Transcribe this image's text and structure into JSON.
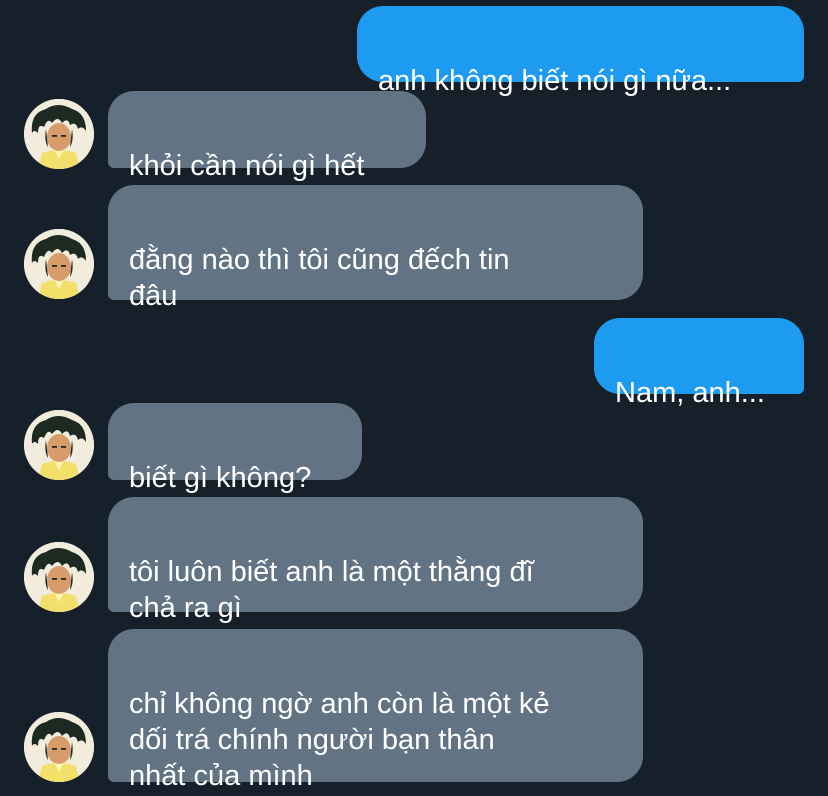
{
  "messages": [
    {
      "direction": "outgoing",
      "text": "anh không biết nói gì nữa..."
    },
    {
      "direction": "incoming",
      "text": "khỏi cần nói gì hết"
    },
    {
      "direction": "incoming",
      "text": "đằng nào thì tôi cũng đếch tin\nđâu"
    },
    {
      "direction": "outgoing",
      "text": "Nam, anh..."
    },
    {
      "direction": "incoming",
      "text": "biết gì không?"
    },
    {
      "direction": "incoming",
      "text": "tôi luôn biết anh là một thằng đĩ\nchả ra gì"
    },
    {
      "direction": "incoming",
      "text": "chỉ không ngờ anh còn là một kẻ\ndối trá chính người bạn thân\nnhất của mình"
    }
  ],
  "avatar": {
    "icon": "anime-character-avatar-icon"
  },
  "colors": {
    "background": "#16202b",
    "outgoing_bubble": "#1d9bf0",
    "incoming_bubble": "#627384",
    "text": "#ffffff"
  }
}
